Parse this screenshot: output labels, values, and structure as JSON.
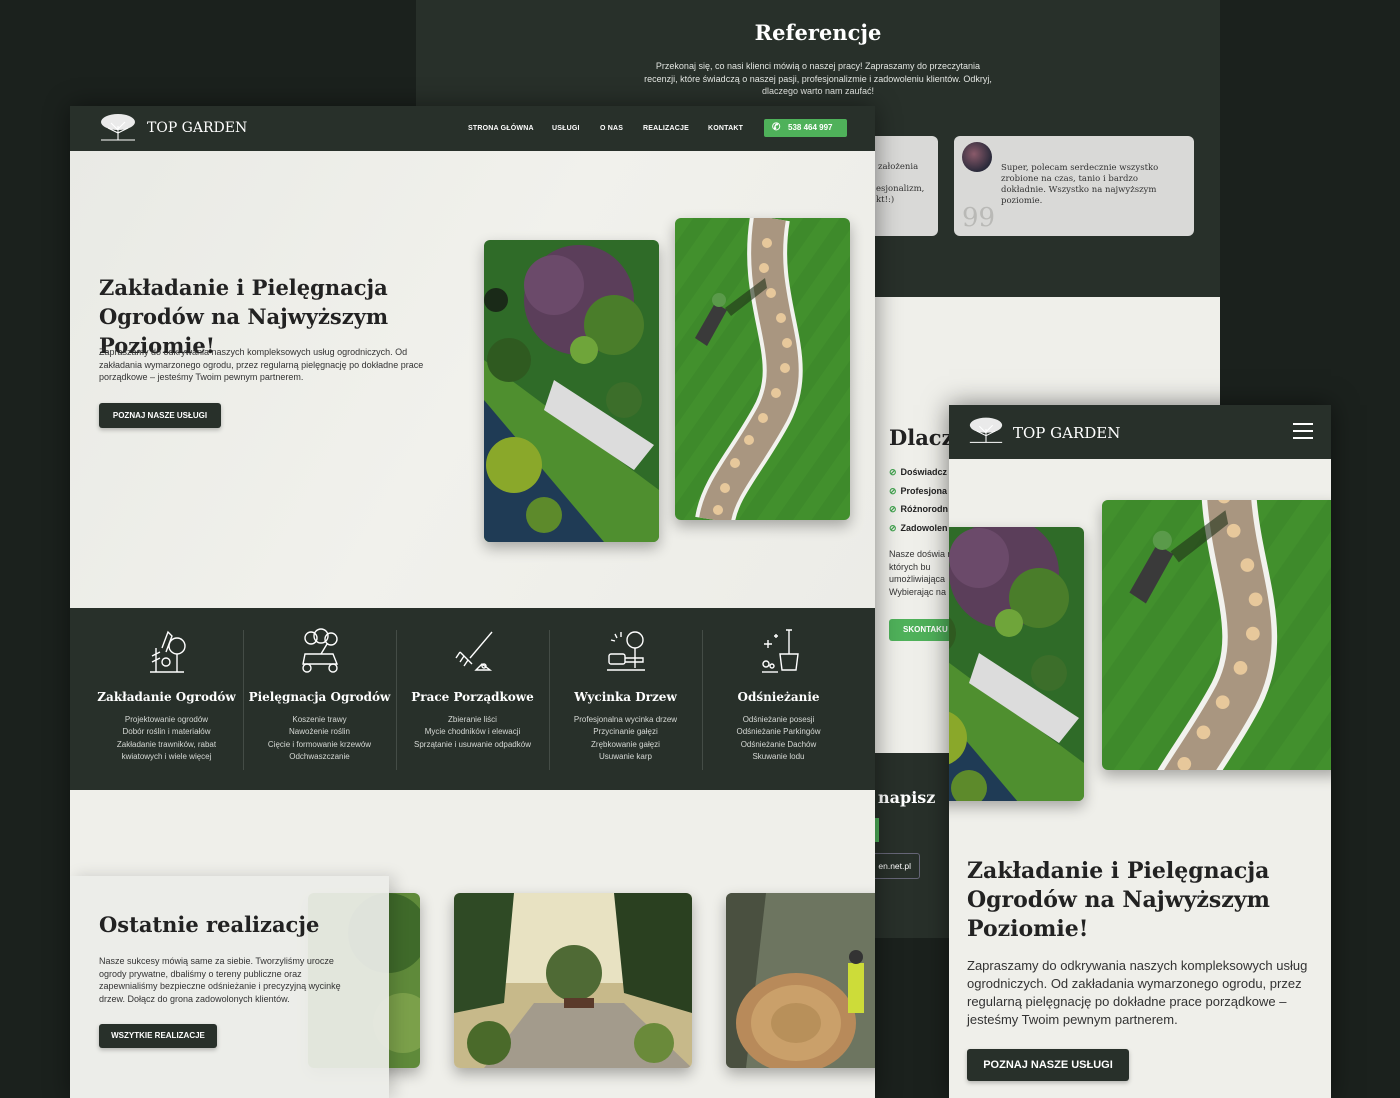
{
  "brand": {
    "name": "TOP GARDEN",
    "accent": "#4fb15a",
    "dark": "#28302a",
    "light": "#efefea"
  },
  "references": {
    "title": "Referencje",
    "text": "Przekonaj się, co nasi klienci mówią o naszej pracy! Zapraszamy do przeczytania recenzji, które świadczą o naszej pasji, profesjonalizmie i zadowoleniu klientów. Odkryj, dlaczego warto nam zaufać!",
    "card1_lines": [
      "założenia",
      "esjonalizm,",
      "kt!:)"
    ],
    "card2_text": "Super, polecam serdecznie wszystko zrobione na czas, tanio i bardzo dokładnie. Wszystko na najwyższym poziomie.",
    "quote_glyph": "99"
  },
  "why": {
    "title": "Dlacz",
    "checks": [
      "Doświadcz",
      "Profesjona",
      "Różnorodn",
      "Zadowolen"
    ],
    "para": "Nasze doświa na których bu umożliwiająca Wybierając na",
    "button": "SKONTAKU",
    "write": "napisz",
    "email": "en.net.pl"
  },
  "nav": {
    "items": [
      "STRONA GŁÓWNA",
      "USŁUGI",
      "O NAS",
      "REALIZACJE",
      "KONTAKT"
    ],
    "phone": "538 464 997"
  },
  "hero": {
    "title": "Zakładanie i Pielęgnacja Ogrodów na Najwyższym Poziomie!",
    "text": "Zapraszamy do odkrywania naszych kompleksowych usług ogrodniczych. Od zakładania wymarzonego ogrodu, przez regularną pielęgnację po dokładne prace porządkowe – jesteśmy Twoim pewnym partnerem.",
    "button": "POZNAJ NASZE USŁUGI"
  },
  "services": [
    {
      "title": "Zakładanie Ogrodów",
      "icon": "planting-icon",
      "lines": [
        "Projektowanie ogrodów",
        "Dobór roślin i materiałów",
        "Zakładanie trawników, rabat",
        "kwiatowych i wiele więcej"
      ]
    },
    {
      "title": "Pielęgnacja Ogrodów",
      "icon": "lawnmower-icon",
      "lines": [
        "Koszenie trawy",
        "Nawożenie roślin",
        "Cięcie i formowanie krzewów",
        "Odchwaszczanie"
      ]
    },
    {
      "title": "Prace Porządkowe",
      "icon": "rake-icon",
      "lines": [
        "Zbieranie liści",
        "Mycie chodników i elewacji",
        "Sprzątanie i usuwanie odpadków"
      ]
    },
    {
      "title": "Wycinka Drzew",
      "icon": "chainsaw-icon",
      "lines": [
        "Profesjonalna wycinka drzew",
        "Przycinanie gałęzi",
        "Zrębkowanie gałęzi",
        "Usuwanie karp"
      ]
    },
    {
      "title": "Odśnieżanie",
      "icon": "snow-shovel-icon",
      "lines": [
        "Odśnieżanie posesji",
        "Odśnieżanie Parkingów",
        "Odśnieżanie Dachów",
        "Skuwanie lodu"
      ]
    }
  ],
  "realizations": {
    "title": "Ostatnie realizacje",
    "text": "Nasze sukcesy mówią same za siebie. Tworzyliśmy urocze ogrody prywatne, dbaliśmy o tereny publiczne oraz zapewnialiśmy bezpieczne odśnieżanie i precyzyjną wycinkę drzew. Dołącz do grona zadowolonych klientów.",
    "button": "WSZYTKIE REALIZACJE"
  },
  "mobile": {
    "title": "Zakładanie i Pielęgnacja Ogrodów na Najwyższym Poziomie!",
    "text": "Zapraszamy do odkrywania naszych kompleksowych usług ogrodniczych. Od zakładania wymarzonego ogrodu, przez regularną pielęgnację po dokładne prace porządkowe – jesteśmy Twoim pewnym partnerem.",
    "button": "POZNAJ NASZE USŁUGI"
  }
}
